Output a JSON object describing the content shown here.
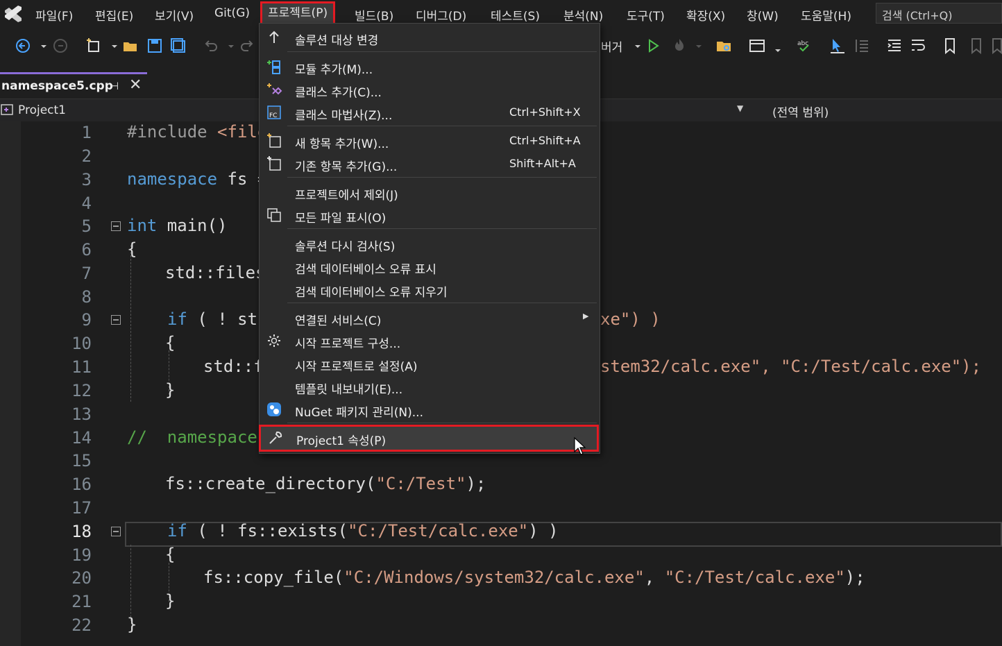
{
  "menubar": {
    "items": [
      "파일(F)",
      "편집(E)",
      "보기(V)",
      "Git(G)",
      "프로젝트(P)",
      "빌드(B)",
      "디버그(D)",
      "테스트(S)",
      "분석(N)",
      "도구(T)",
      "확장(X)",
      "창(W)",
      "도움말(H)"
    ],
    "search_placeholder": "검색 (Ctrl+Q)"
  },
  "toolbar": {
    "debugger_label": "버거"
  },
  "tab": {
    "label": "namespace5.cpp",
    "pin": "⊣",
    "close": "✕"
  },
  "navbar": {
    "project": "Project1",
    "scope": "(전역 범위)"
  },
  "editor": {
    "current_line": 18,
    "lines": [
      {
        "n": "1"
      },
      {
        "n": "2"
      },
      {
        "n": "3"
      },
      {
        "n": "4"
      },
      {
        "n": "5"
      },
      {
        "n": "6"
      },
      {
        "n": "7"
      },
      {
        "n": "8"
      },
      {
        "n": "9"
      },
      {
        "n": "10"
      },
      {
        "n": "11"
      },
      {
        "n": "12"
      },
      {
        "n": "13"
      },
      {
        "n": "14"
      },
      {
        "n": "15"
      },
      {
        "n": "16"
      },
      {
        "n": "17"
      },
      {
        "n": "18"
      },
      {
        "n": "19"
      },
      {
        "n": "20"
      },
      {
        "n": "21"
      },
      {
        "n": "22"
      }
    ],
    "code": {
      "l1a": "#include ",
      "l1b": "<file",
      "l3a": "namespace",
      " l3b": " fs =",
      "l5a": "int",
      " l5b": " main()",
      "l6": "{",
      "l7": "std::files",
      "l9a": "if",
      " l9b": " ( ! stc",
      "l9c": "xe\") )",
      "l10": "{",
      "l11a": "std::f",
      "l11b": "stem32/calc.exe\", \"C:/Test/calc.exe\");",
      "l12": "}",
      "l14a": "//  namespace",
      "l16a": "fs::create_directory(",
      "l16b": "\"C:/Test\"",
      "l16c": ");",
      "l18a": "if",
      " l18b": " ( ! fs::exists(",
      "l18c": "\"C:/Test/calc.exe\"",
      "l18d": ") )",
      "l19": "{",
      "l20a": "fs::copy_file(",
      "l20b": "\"C:/Windows/system32/calc.exe\"",
      "l20c": ", ",
      "l20d": "\"C:/Test/calc.exe\"",
      "l20e": ");",
      "l21": "}",
      "l22": "}"
    }
  },
  "project_menu": {
    "items": [
      {
        "label": "솔루션 대상 변경",
        "shortcut": ""
      },
      {
        "label": "모듈 추가(M)...",
        "shortcut": ""
      },
      {
        "label": "클래스 추가(C)...",
        "shortcut": ""
      },
      {
        "label": "클래스 마법사(Z)...",
        "shortcut": "Ctrl+Shift+X"
      },
      {
        "label": "새 항목 추가(W)...",
        "shortcut": "Ctrl+Shift+A"
      },
      {
        "label": "기존 항목 추가(G)...",
        "shortcut": "Shift+Alt+A"
      },
      {
        "label": "프로젝트에서 제외(J)",
        "shortcut": ""
      },
      {
        "label": "모든 파일 표시(O)",
        "shortcut": ""
      },
      {
        "label": "솔루션 다시 검사(S)",
        "shortcut": ""
      },
      {
        "label": "검색 데이터베이스 오류 표시",
        "shortcut": ""
      },
      {
        "label": "검색 데이터베이스 오류 지우기",
        "shortcut": ""
      },
      {
        "label": "연결된 서비스(C)",
        "shortcut": ""
      },
      {
        "label": "시작 프로젝트 구성...",
        "shortcut": ""
      },
      {
        "label": "시작 프로젝트로 설정(A)",
        "shortcut": ""
      },
      {
        "label": "템플릿 내보내기(E)...",
        "shortcut": ""
      },
      {
        "label": "NuGet 패키지 관리(N)...",
        "shortcut": ""
      },
      {
        "label": "Project1 속성(P)",
        "shortcut": ""
      }
    ]
  },
  "colors": {
    "highlight_border": "#e31b23",
    "accent": "#8a6cd8",
    "keyword": "#569cd6",
    "string": "#d69d85",
    "comment": "#57a64a"
  }
}
